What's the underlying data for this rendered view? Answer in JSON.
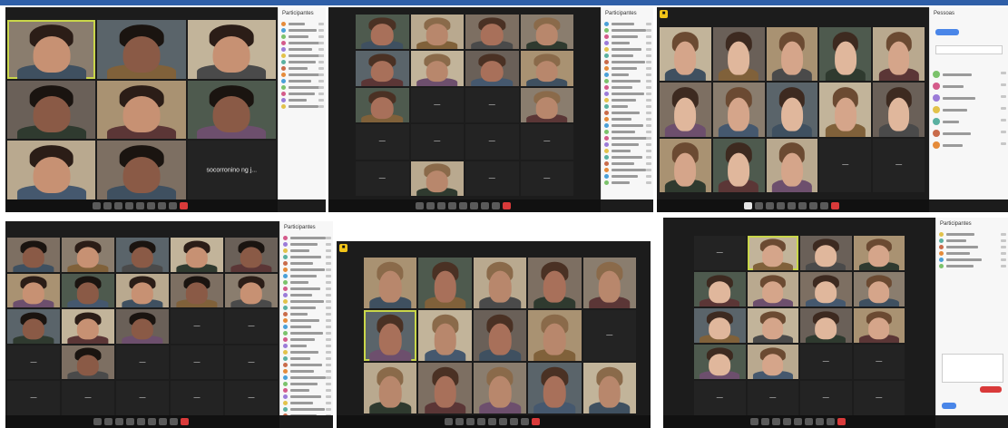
{
  "screens": [
    {
      "name": "screen-1",
      "grid": {
        "cols": 3,
        "rows": 3
      },
      "tiles": [
        {
          "type": "video"
        },
        {
          "type": "video"
        },
        {
          "type": "video"
        },
        {
          "type": "video"
        },
        {
          "type": "video"
        },
        {
          "type": "video"
        },
        {
          "type": "video"
        },
        {
          "type": "video"
        },
        {
          "type": "name",
          "label": "socorronino ng j..."
        }
      ],
      "panel": {
        "title": "Participantes",
        "rows": 14
      },
      "active_index": 0
    },
    {
      "name": "screen-2",
      "grid": {
        "cols": 4,
        "rows": 5
      },
      "tiles": [
        {
          "type": "video"
        },
        {
          "type": "video"
        },
        {
          "type": "video"
        },
        {
          "type": "video"
        },
        {
          "type": "video"
        },
        {
          "type": "video"
        },
        {
          "type": "video"
        },
        {
          "type": "video"
        },
        {
          "type": "video"
        },
        {
          "type": "name",
          "label": "—"
        },
        {
          "type": "name",
          "label": "—"
        },
        {
          "type": "video"
        },
        {
          "type": "name",
          "label": "—"
        },
        {
          "type": "name",
          "label": "—"
        },
        {
          "type": "name",
          "label": "—"
        },
        {
          "type": "name",
          "label": "—"
        },
        {
          "type": "name",
          "label": "—"
        },
        {
          "type": "video"
        },
        {
          "type": "name",
          "label": "—"
        },
        {
          "type": "name",
          "label": "—"
        }
      ],
      "panel": {
        "title": "Participantes",
        "rows": 26
      },
      "active_index": -1
    },
    {
      "name": "screen-3",
      "grid": {
        "cols": 5,
        "rows": 3
      },
      "tiles": [
        {
          "type": "video"
        },
        {
          "type": "video"
        },
        {
          "type": "video"
        },
        {
          "type": "video"
        },
        {
          "type": "video"
        },
        {
          "type": "video"
        },
        {
          "type": "video"
        },
        {
          "type": "video"
        },
        {
          "type": "video"
        },
        {
          "type": "video"
        },
        {
          "type": "video"
        },
        {
          "type": "video"
        },
        {
          "type": "video"
        },
        {
          "type": "name",
          "label": "—"
        },
        {
          "type": "name",
          "label": "—"
        }
      ],
      "panel": {
        "title": "Pessoas",
        "rows": 7
      },
      "active_index": -1,
      "badge": "■"
    },
    {
      "name": "screen-4",
      "grid": {
        "cols": 5,
        "rows": 5
      },
      "tiles": [
        {
          "type": "video"
        },
        {
          "type": "video"
        },
        {
          "type": "video"
        },
        {
          "type": "video"
        },
        {
          "type": "video"
        },
        {
          "type": "video"
        },
        {
          "type": "video"
        },
        {
          "type": "video"
        },
        {
          "type": "video"
        },
        {
          "type": "video"
        },
        {
          "type": "video"
        },
        {
          "type": "video"
        },
        {
          "type": "video"
        },
        {
          "type": "name",
          "label": "—"
        },
        {
          "type": "name",
          "label": "—"
        },
        {
          "type": "name",
          "label": "—"
        },
        {
          "type": "video"
        },
        {
          "type": "name",
          "label": "—"
        },
        {
          "type": "name",
          "label": "—"
        },
        {
          "type": "name",
          "label": "—"
        },
        {
          "type": "name",
          "label": "—"
        },
        {
          "type": "name",
          "label": "—"
        },
        {
          "type": "name",
          "label": "—"
        },
        {
          "type": "name",
          "label": "—"
        },
        {
          "type": "name",
          "label": "—"
        }
      ],
      "panel": {
        "title": "Participantes",
        "rows": 30
      },
      "active_index": -1
    },
    {
      "name": "screen-5",
      "grid": {
        "cols": 5,
        "rows": 3
      },
      "tiles": [
        {
          "type": "video"
        },
        {
          "type": "video"
        },
        {
          "type": "video"
        },
        {
          "type": "video"
        },
        {
          "type": "video"
        },
        {
          "type": "video"
        },
        {
          "type": "video"
        },
        {
          "type": "video"
        },
        {
          "type": "video"
        },
        {
          "type": "name",
          "label": "—"
        },
        {
          "type": "video"
        },
        {
          "type": "video"
        },
        {
          "type": "video"
        },
        {
          "type": "video"
        },
        {
          "type": "video"
        }
      ],
      "panel": null,
      "active_index": 5,
      "badge": "■"
    },
    {
      "name": "screen-6",
      "grid": {
        "cols": 4,
        "rows": 5
      },
      "tiles": [
        {
          "type": "name",
          "label": "—"
        },
        {
          "type": "video"
        },
        {
          "type": "video"
        },
        {
          "type": "video"
        },
        {
          "type": "video"
        },
        {
          "type": "video"
        },
        {
          "type": "video"
        },
        {
          "type": "video"
        },
        {
          "type": "video"
        },
        {
          "type": "video"
        },
        {
          "type": "video"
        },
        {
          "type": "video"
        },
        {
          "type": "video"
        },
        {
          "type": "video"
        },
        {
          "type": "name",
          "label": "—"
        },
        {
          "type": "name",
          "label": "—"
        },
        {
          "type": "name",
          "label": "—"
        },
        {
          "type": "name",
          "label": "—"
        },
        {
          "type": "name",
          "label": "—"
        },
        {
          "type": "name",
          "label": "—"
        }
      ],
      "panel": {
        "title": "Participantes",
        "rows": 6
      },
      "active_index": 1
    }
  ],
  "colors": {
    "top_strip": "#2f5fa8",
    "meeting_bg": "#1c1c1c",
    "tile_bg": "#2a2a2a",
    "end_button": "#d93a3a",
    "active_border": "#c9d64a",
    "badge": "#f2c418"
  }
}
